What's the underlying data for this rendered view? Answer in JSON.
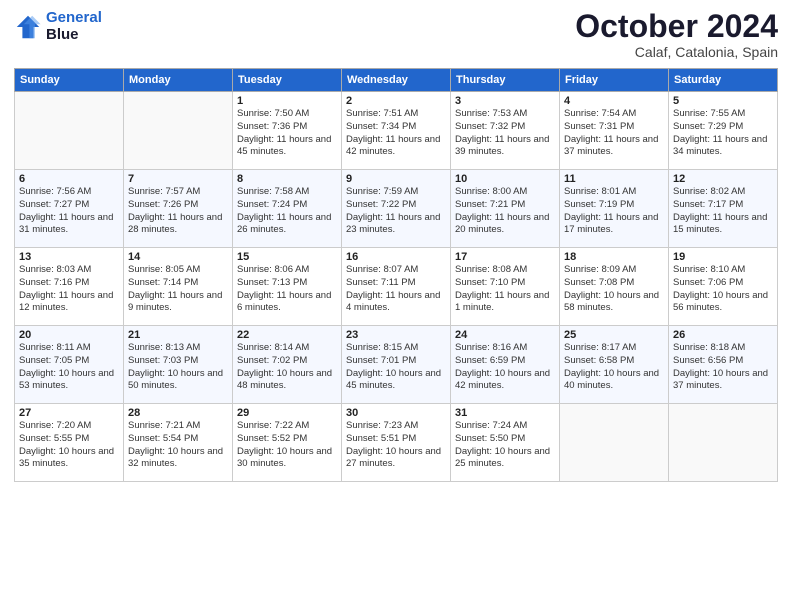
{
  "header": {
    "logo_line1": "General",
    "logo_line2": "Blue",
    "month": "October 2024",
    "location": "Calaf, Catalonia, Spain"
  },
  "weekdays": [
    "Sunday",
    "Monday",
    "Tuesday",
    "Wednesday",
    "Thursday",
    "Friday",
    "Saturday"
  ],
  "weeks": [
    [
      {
        "day": "",
        "info": ""
      },
      {
        "day": "",
        "info": ""
      },
      {
        "day": "1",
        "info": "Sunrise: 7:50 AM\nSunset: 7:36 PM\nDaylight: 11 hours and 45 minutes."
      },
      {
        "day": "2",
        "info": "Sunrise: 7:51 AM\nSunset: 7:34 PM\nDaylight: 11 hours and 42 minutes."
      },
      {
        "day": "3",
        "info": "Sunrise: 7:53 AM\nSunset: 7:32 PM\nDaylight: 11 hours and 39 minutes."
      },
      {
        "day": "4",
        "info": "Sunrise: 7:54 AM\nSunset: 7:31 PM\nDaylight: 11 hours and 37 minutes."
      },
      {
        "day": "5",
        "info": "Sunrise: 7:55 AM\nSunset: 7:29 PM\nDaylight: 11 hours and 34 minutes."
      }
    ],
    [
      {
        "day": "6",
        "info": "Sunrise: 7:56 AM\nSunset: 7:27 PM\nDaylight: 11 hours and 31 minutes."
      },
      {
        "day": "7",
        "info": "Sunrise: 7:57 AM\nSunset: 7:26 PM\nDaylight: 11 hours and 28 minutes."
      },
      {
        "day": "8",
        "info": "Sunrise: 7:58 AM\nSunset: 7:24 PM\nDaylight: 11 hours and 26 minutes."
      },
      {
        "day": "9",
        "info": "Sunrise: 7:59 AM\nSunset: 7:22 PM\nDaylight: 11 hours and 23 minutes."
      },
      {
        "day": "10",
        "info": "Sunrise: 8:00 AM\nSunset: 7:21 PM\nDaylight: 11 hours and 20 minutes."
      },
      {
        "day": "11",
        "info": "Sunrise: 8:01 AM\nSunset: 7:19 PM\nDaylight: 11 hours and 17 minutes."
      },
      {
        "day": "12",
        "info": "Sunrise: 8:02 AM\nSunset: 7:17 PM\nDaylight: 11 hours and 15 minutes."
      }
    ],
    [
      {
        "day": "13",
        "info": "Sunrise: 8:03 AM\nSunset: 7:16 PM\nDaylight: 11 hours and 12 minutes."
      },
      {
        "day": "14",
        "info": "Sunrise: 8:05 AM\nSunset: 7:14 PM\nDaylight: 11 hours and 9 minutes."
      },
      {
        "day": "15",
        "info": "Sunrise: 8:06 AM\nSunset: 7:13 PM\nDaylight: 11 hours and 6 minutes."
      },
      {
        "day": "16",
        "info": "Sunrise: 8:07 AM\nSunset: 7:11 PM\nDaylight: 11 hours and 4 minutes."
      },
      {
        "day": "17",
        "info": "Sunrise: 8:08 AM\nSunset: 7:10 PM\nDaylight: 11 hours and 1 minute."
      },
      {
        "day": "18",
        "info": "Sunrise: 8:09 AM\nSunset: 7:08 PM\nDaylight: 10 hours and 58 minutes."
      },
      {
        "day": "19",
        "info": "Sunrise: 8:10 AM\nSunset: 7:06 PM\nDaylight: 10 hours and 56 minutes."
      }
    ],
    [
      {
        "day": "20",
        "info": "Sunrise: 8:11 AM\nSunset: 7:05 PM\nDaylight: 10 hours and 53 minutes."
      },
      {
        "day": "21",
        "info": "Sunrise: 8:13 AM\nSunset: 7:03 PM\nDaylight: 10 hours and 50 minutes."
      },
      {
        "day": "22",
        "info": "Sunrise: 8:14 AM\nSunset: 7:02 PM\nDaylight: 10 hours and 48 minutes."
      },
      {
        "day": "23",
        "info": "Sunrise: 8:15 AM\nSunset: 7:01 PM\nDaylight: 10 hours and 45 minutes."
      },
      {
        "day": "24",
        "info": "Sunrise: 8:16 AM\nSunset: 6:59 PM\nDaylight: 10 hours and 42 minutes."
      },
      {
        "day": "25",
        "info": "Sunrise: 8:17 AM\nSunset: 6:58 PM\nDaylight: 10 hours and 40 minutes."
      },
      {
        "day": "26",
        "info": "Sunrise: 8:18 AM\nSunset: 6:56 PM\nDaylight: 10 hours and 37 minutes."
      }
    ],
    [
      {
        "day": "27",
        "info": "Sunrise: 7:20 AM\nSunset: 5:55 PM\nDaylight: 10 hours and 35 minutes."
      },
      {
        "day": "28",
        "info": "Sunrise: 7:21 AM\nSunset: 5:54 PM\nDaylight: 10 hours and 32 minutes."
      },
      {
        "day": "29",
        "info": "Sunrise: 7:22 AM\nSunset: 5:52 PM\nDaylight: 10 hours and 30 minutes."
      },
      {
        "day": "30",
        "info": "Sunrise: 7:23 AM\nSunset: 5:51 PM\nDaylight: 10 hours and 27 minutes."
      },
      {
        "day": "31",
        "info": "Sunrise: 7:24 AM\nSunset: 5:50 PM\nDaylight: 10 hours and 25 minutes."
      },
      {
        "day": "",
        "info": ""
      },
      {
        "day": "",
        "info": ""
      }
    ]
  ]
}
